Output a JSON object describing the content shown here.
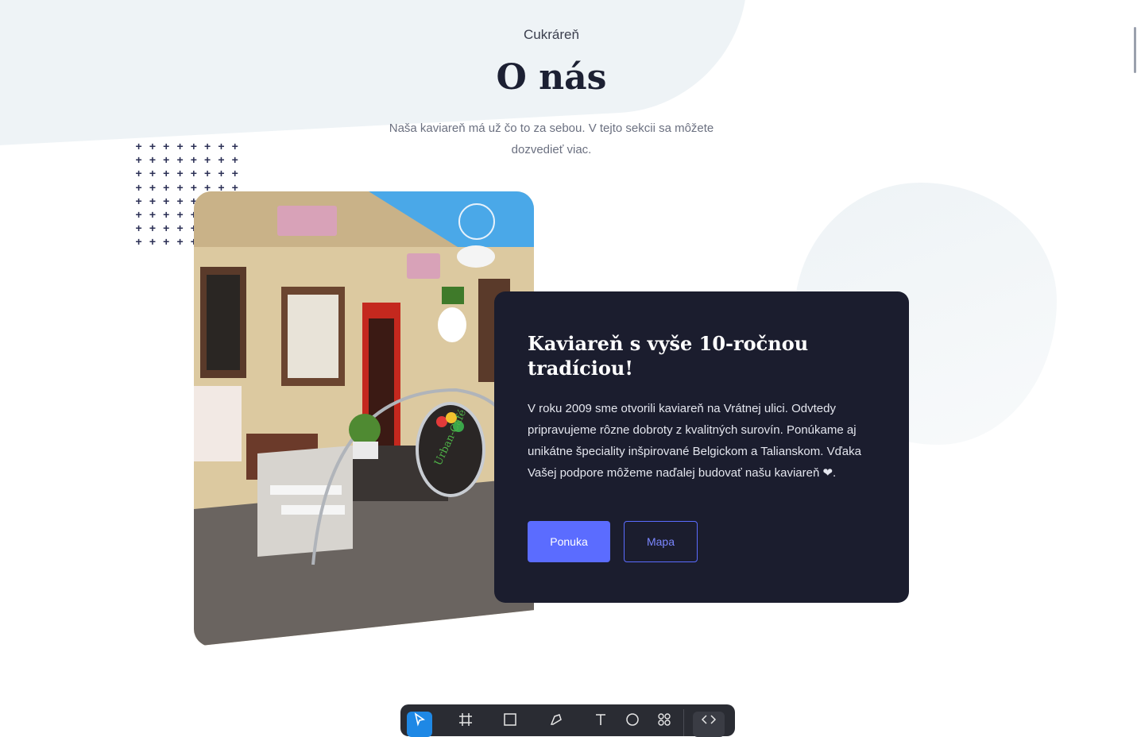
{
  "section": {
    "eyebrow": "Cukráreň",
    "title": "O nás",
    "lede": "Naša kaviareň má už čo to za sebou. V tejto sekcii sa môžete dozvedieť viac."
  },
  "card": {
    "title": "Kaviareň s vyše 10-ročnou tradíciou!",
    "text": "V roku 2009 sme otvorili kaviareň na Vrátnej ulici. Odvtedy pripravujeme rôzne dobroty z kvalitných surovín. Ponúkame aj unikátne špeciality inšpirované Belgickom a Talianskom. Vďaka Vašej podpore môžeme naďalej budovať našu kaviareň ❤.",
    "primary_button": "Ponuka",
    "secondary_button": "Mapa"
  },
  "photo": {
    "sign_text": "Urban-Café"
  },
  "colors": {
    "accent": "#5b6cff",
    "card_bg": "#1b1d2e",
    "heading": "#1c2033"
  },
  "toolbar": {
    "icons": [
      "pointer-icon",
      "frame-icon",
      "rectangle-icon",
      "pen-icon",
      "text-icon",
      "comment-icon",
      "components-icon",
      "code-icon"
    ]
  }
}
